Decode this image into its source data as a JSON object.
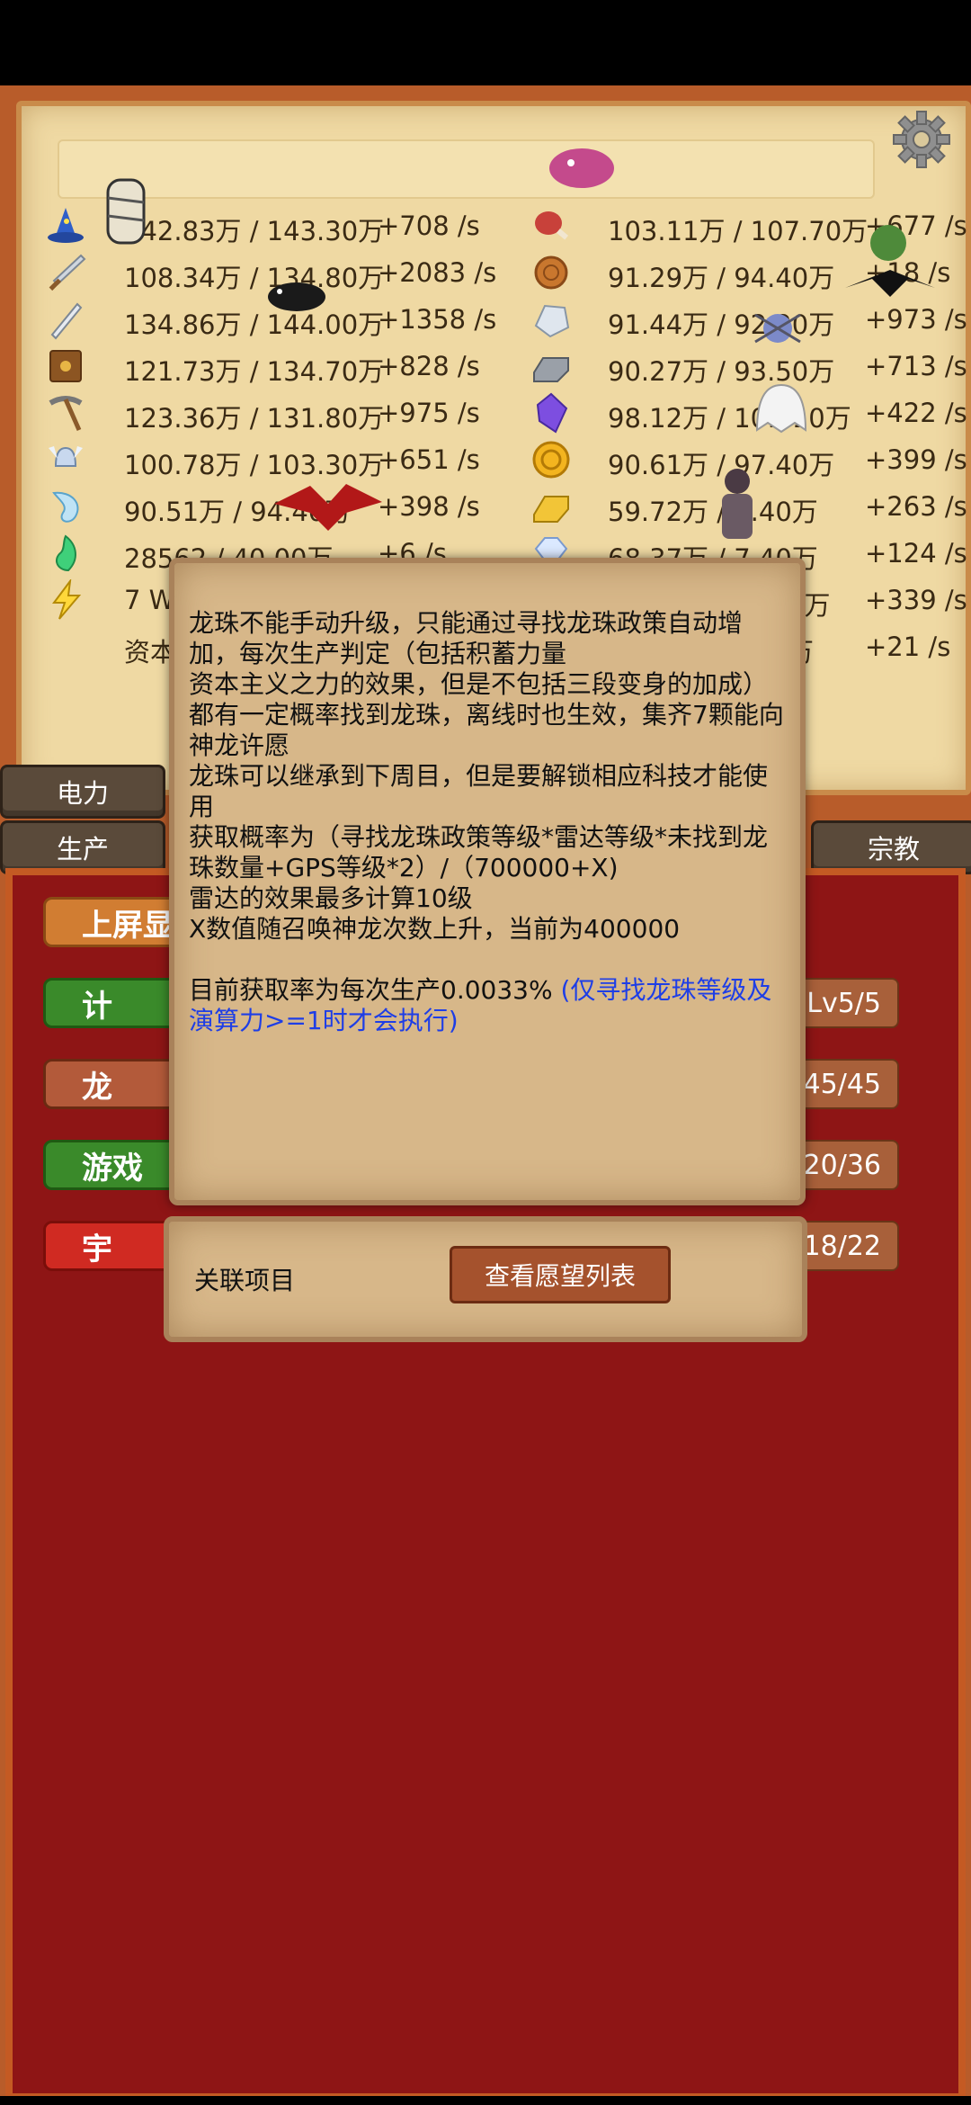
{
  "resources_left": [
    {
      "icon": "wizard-hat-icon",
      "value": "142.83万 / 143.30万",
      "rate": "+708 /s"
    },
    {
      "icon": "sword-icon",
      "value": "108.34万 / 134.80万",
      "rate": "+2083 /s"
    },
    {
      "icon": "dagger-icon",
      "value": "134.86万 / 144.00万",
      "rate": "+1358 /s"
    },
    {
      "icon": "book-icon",
      "value": "121.73万 / 134.70万",
      "rate": "+828 /s"
    },
    {
      "icon": "pickaxe-icon",
      "value": "123.36万 / 131.80万",
      "rate": "+975 /s"
    },
    {
      "icon": "winged-helmet-icon",
      "value": "100.78万 / 103.30万",
      "rate": "+651 /s"
    },
    {
      "icon": "spirit-icon",
      "value": "90.51万 / 94.40万",
      "rate": "+398 /s"
    },
    {
      "icon": "green-flame-icon",
      "value": "28562 / 40.00万",
      "rate": "+6 /s"
    },
    {
      "icon": "lightning-icon",
      "value": "7 W",
      "rate": ""
    },
    {
      "icon": "",
      "value": "资本",
      "rate": ""
    }
  ],
  "resources_right": [
    {
      "icon": "meat-icon",
      "value": "103.11万 / 107.70万",
      "rate": "+677 /s"
    },
    {
      "icon": "wood-icon",
      "value": "91.29万 / 94.40万",
      "rate": "+18 /s"
    },
    {
      "icon": "stone-icon",
      "value": "91.44万 / 92.20万",
      "rate": "+973 /s"
    },
    {
      "icon": "iron-ingot-icon",
      "value": "90.27万 / 93.50万",
      "rate": "+713 /s"
    },
    {
      "icon": "crystal-icon",
      "value": "98.12万 / 101.10万",
      "rate": "+422 /s"
    },
    {
      "icon": "gold-coin-icon",
      "value": "90.61万 / 97.40万",
      "rate": "+399 /s"
    },
    {
      "icon": "gold-bar-icon",
      "value": "59.72万 / 7.40万",
      "rate": "+263 /s"
    },
    {
      "icon": "diamond-icon",
      "value": "68.37万 / 7.40万",
      "rate": "+124 /s"
    },
    {
      "icon": "",
      "value": "0万",
      "rate": "+339 /s"
    },
    {
      "icon": "",
      "value": "万",
      "rate": "+21 /s"
    }
  ],
  "tabs": {
    "power": "电力",
    "production": "生产",
    "religion": "宗教"
  },
  "panel_buttons": [
    {
      "label": "上屏显",
      "level": ""
    },
    {
      "label": "计",
      "level": "Lv5/5"
    },
    {
      "label": "龙",
      "level": "v45/45"
    },
    {
      "label": "游戏",
      "level": "v20/36"
    },
    {
      "label": "宇",
      "level": "v18/22"
    }
  ],
  "dialog": {
    "lines": [
      "龙珠不能手动升级，只能通过寻找龙珠政策自动增加，每次生产判定（包括积蓄力量",
      "资本主义之力的效果，但是不包括三段变身的加成）都有一定概率找到龙珠，离线时也生效，集齐7颗能向神龙许愿",
      "龙珠可以继承到下周目，但是要解锁相应科技才能使用",
      "获取概率为（寻找龙珠政策等级*雷达等级*未找到龙珠数量+GPS等级*2）/（700000+X)",
      "雷达的效果最多计算10级",
      "X数值随召唤神龙次数上升，当前为400000"
    ],
    "rate_text": "目前获取率为每次生产0.0033%",
    "note_text": "(仅寻找龙珠等级及演算力>=1时才会执行)",
    "related_label": "关联项目",
    "wish_button": "查看愿望列表"
  },
  "colors": {
    "parchment": "#efd9a3",
    "red_panel": "#8e1515",
    "note_blue": "#1e3ee6"
  }
}
